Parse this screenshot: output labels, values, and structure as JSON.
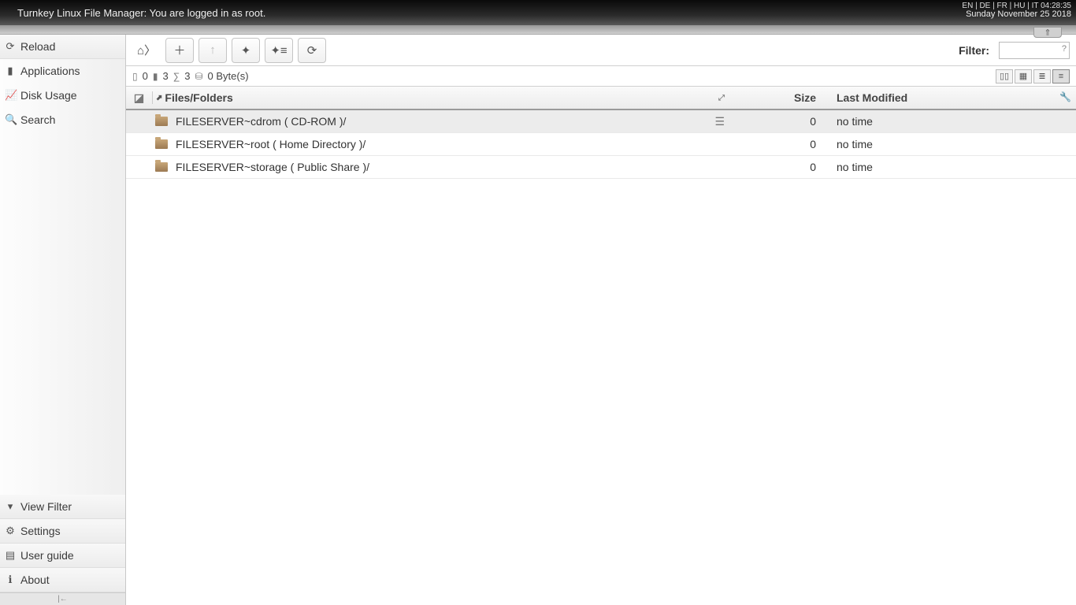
{
  "topbar": {
    "title": "Turnkey Linux File Manager: You are logged in as root.",
    "languages": "EN | DE | FR | HU | IT   04:28:35",
    "date": "Sunday November 25 2018"
  },
  "sidebar": {
    "reload": "Reload",
    "applications": "Applications",
    "disk_usage": "Disk Usage",
    "search": "Search",
    "view_filter": "View Filter",
    "settings": "Settings",
    "user_guide": "User guide",
    "about": "About"
  },
  "toolbar": {
    "filter_label": "Filter:",
    "filter_placeholder": ""
  },
  "status": {
    "files": "0",
    "folders": "3",
    "sum": "3",
    "size": "0 Byte(s)"
  },
  "columns": {
    "name": "Files/Folders",
    "size": "Size",
    "modified": "Last Modified"
  },
  "rows": [
    {
      "name": "FILESERVER~cdrom ( CD-ROM )/",
      "size": "0",
      "modified": "no time",
      "selected": true
    },
    {
      "name": "FILESERVER~root ( Home Directory )/",
      "size": "0",
      "modified": "no time",
      "selected": false
    },
    {
      "name": "FILESERVER~storage ( Public Share )/",
      "size": "0",
      "modified": "no time",
      "selected": false
    }
  ]
}
